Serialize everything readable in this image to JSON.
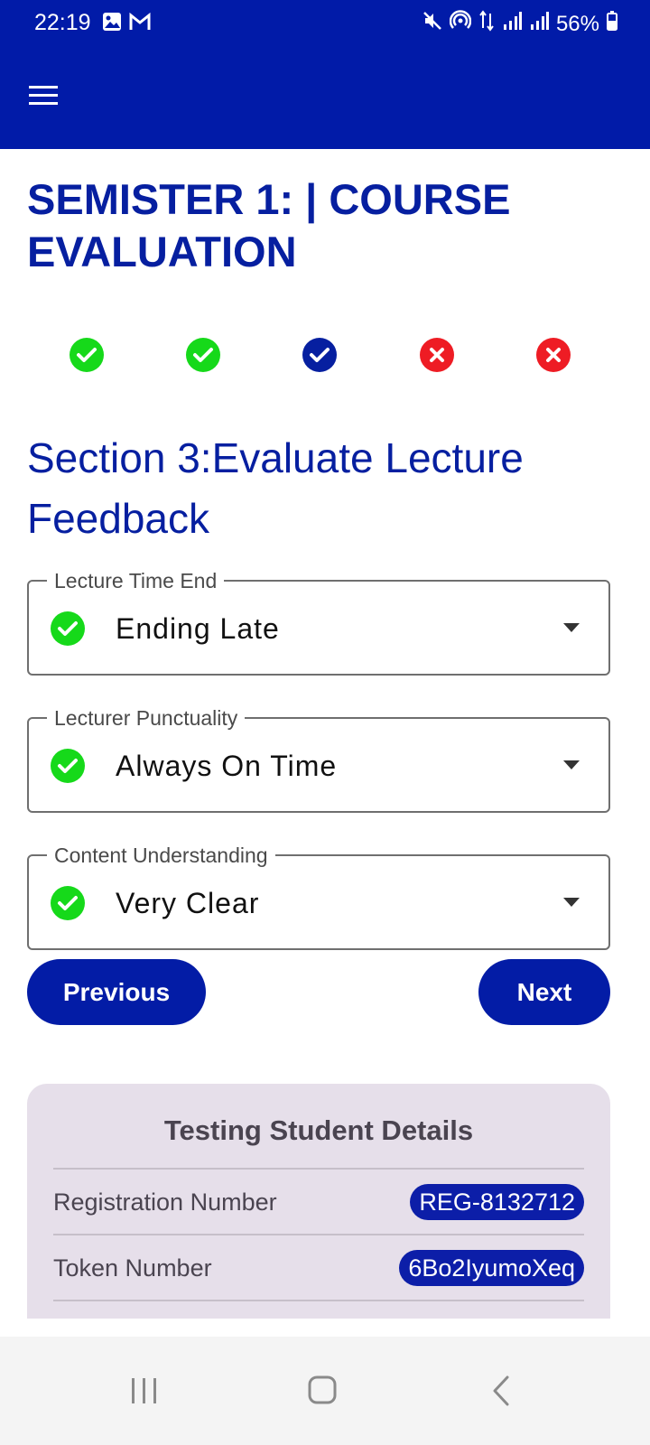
{
  "status_bar": {
    "time": "22:19",
    "battery": "56%",
    "left_icons": [
      "image-icon",
      "gmail-icon"
    ],
    "right_icons": [
      "mute-icon",
      "hotspot-icon",
      "data-icon",
      "signal-icon",
      "signal-icon",
      "battery-icon"
    ]
  },
  "app_bar": {
    "menu_icon": "hamburger-menu-icon",
    "color": "#011ba8"
  },
  "page": {
    "title": "SEMISTER 1: | COURSE EVALUATION"
  },
  "steps": [
    {
      "state": "done",
      "icon": "check-icon",
      "color": "#16d91a"
    },
    {
      "state": "done",
      "icon": "check-icon",
      "color": "#16d91a"
    },
    {
      "state": "current",
      "icon": "check-icon",
      "color": "#061fa0"
    },
    {
      "state": "pending",
      "icon": "close-icon",
      "color": "#ee1c24"
    },
    {
      "state": "pending",
      "icon": "close-icon",
      "color": "#ee1c24"
    }
  ],
  "section": {
    "title": "Section 3:Evaluate Lecture Feedback"
  },
  "fields": [
    {
      "label": "Lecture Time End",
      "value": "Ending Late"
    },
    {
      "label": "Lecturer Punctuality",
      "value": "Always On Time"
    },
    {
      "label": "Content Understanding",
      "value": "Very Clear"
    }
  ],
  "buttons": {
    "previous": "Previous",
    "next": "Next"
  },
  "details": {
    "title": "Testing Student Details",
    "rows": [
      {
        "label": "Registration Number",
        "value": "REG-8132712"
      },
      {
        "label": "Token Number",
        "value": "6Bo2IyumoXeq"
      }
    ]
  },
  "nav_bar": {
    "icons": [
      "recent-apps-icon",
      "home-icon",
      "back-icon"
    ]
  }
}
